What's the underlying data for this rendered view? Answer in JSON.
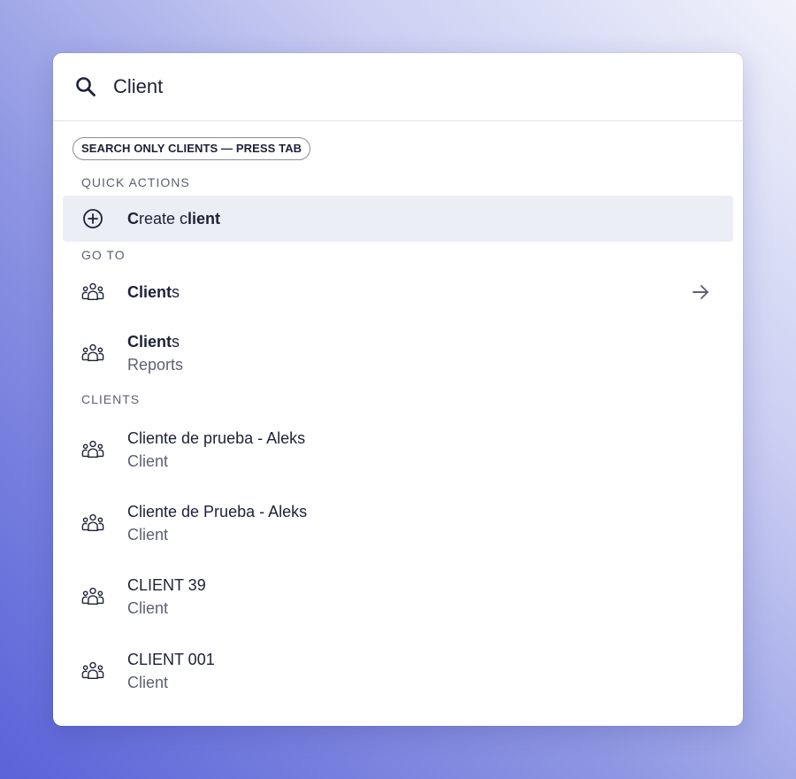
{
  "search": {
    "value": "Client",
    "placeholder": ""
  },
  "scope_chip": "SEARCH ONLY CLIENTS — PRESS TAB",
  "sections": {
    "quick_actions": "QUICK ACTIONS",
    "go_to": "GO TO",
    "clients": "CLIENTS"
  },
  "quick_actions": [
    {
      "parts": [
        "C",
        "reate c",
        "lient"
      ],
      "icon": "plus-circle-icon"
    }
  ],
  "go_to": [
    {
      "bold": "Client",
      "rest": "s",
      "icon": "group-icon"
    },
    {
      "bold": "Client",
      "rest": "s",
      "subtitle": "Reports",
      "icon": "group-icon"
    }
  ],
  "clients": [
    {
      "title": "Cliente de prueba - Aleks",
      "subtitle": "Client",
      "icon": "group-icon"
    },
    {
      "title": "Cliente de Prueba - Aleks",
      "subtitle": "Client",
      "icon": "group-icon"
    },
    {
      "title": "CLIENT 39",
      "subtitle": "Client",
      "icon": "group-icon"
    },
    {
      "title": "CLIENT 001",
      "subtitle": "Client",
      "icon": "group-icon"
    }
  ],
  "colors": {
    "text": "#1d2136",
    "muted": "#5d6171",
    "highlight": "#eceef6",
    "background_start": "#5a63d8",
    "background_end": "#f1f2fb"
  }
}
